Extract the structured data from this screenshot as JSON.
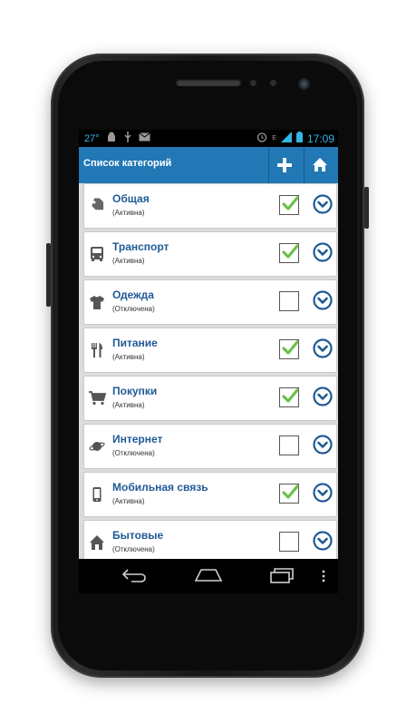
{
  "status_bar": {
    "temperature": "27°",
    "time": "17:09",
    "network": "E"
  },
  "action_bar": {
    "title": "Список категорий",
    "add_icon": "plus-icon",
    "home_icon": "home-icon"
  },
  "colors": {
    "accent": "#2277b5",
    "label": "#1f5a96",
    "check": "#6cc04a",
    "status_text": "#33b5e5"
  },
  "categories": [
    {
      "name": "Общая",
      "state": "(Активна)",
      "checked": true,
      "icon": "tag-icon"
    },
    {
      "name": "Транспорт",
      "state": "(Активна)",
      "checked": true,
      "icon": "bus-icon"
    },
    {
      "name": "Одежда",
      "state": "(Отключена)",
      "checked": false,
      "icon": "shirt-icon"
    },
    {
      "name": "Питание",
      "state": "(Активна)",
      "checked": true,
      "icon": "cutlery-icon"
    },
    {
      "name": "Покупки",
      "state": "(Активна)",
      "checked": true,
      "icon": "cart-icon"
    },
    {
      "name": "Интернет",
      "state": "(Отключена)",
      "checked": false,
      "icon": "planet-icon"
    },
    {
      "name": "Мобильная связь",
      "state": "(Активна)",
      "checked": true,
      "icon": "mobile-phone-icon"
    },
    {
      "name": "Бытовые",
      "state": "(Отключена)",
      "checked": false,
      "icon": "house-icon"
    }
  ],
  "nav_bar": {
    "back_icon": "back-icon",
    "home_icon": "home-nav-icon",
    "recents_icon": "recents-icon",
    "menu_icon": "menu-dots-icon"
  }
}
